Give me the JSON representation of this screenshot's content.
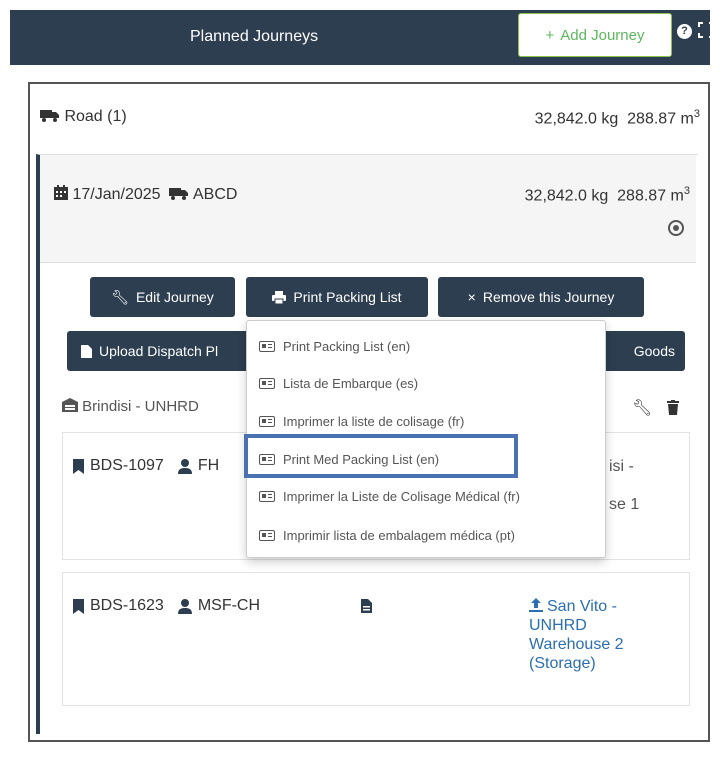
{
  "header": {
    "title": "Planned Journeys",
    "add_label": "Add Journey",
    "help_glyph": "?"
  },
  "road": {
    "label": "Road (1)",
    "weight": "32,842.0 kg",
    "volume": "288.87 m",
    "volume_exp": "3"
  },
  "journey": {
    "date": "17/Jan/2025",
    "vehicle": "ABCD",
    "weight": "32,842.0 kg",
    "volume": "288.87 m",
    "volume_exp": "3"
  },
  "buttons": {
    "edit": "Edit Journey",
    "print": "Print Packing List",
    "remove": "Remove this Journey",
    "upload": "Upload Dispatch Pl",
    "goods": "Goods"
  },
  "origin": "Brindisi - UNHRD",
  "consignments": [
    {
      "ref": "BDS-1097",
      "org": "FH",
      "dest_lines": [
        "isi -",
        "",
        "se 1"
      ]
    },
    {
      "ref": "BDS-1623",
      "org": "MSF-CH",
      "dest_lines": [
        "San Vito -",
        "UNHRD",
        "Warehouse 2",
        "(Storage)"
      ]
    }
  ],
  "print_menu": {
    "items": [
      "Print Packing List (en)",
      "Lista de Embarque (es)",
      "Imprimer la liste de colisage (fr)",
      "Print Med Packing List (en)",
      "Imprimer la Liste de Colisage Médical (fr)",
      "Imprimir lista de embalagem médica (pt)"
    ],
    "highlighted": "Print Med Packing List (en)"
  },
  "colors": {
    "header_bg": "#2c3e50",
    "button_bg": "#2c3e50",
    "accent_green": "#5cb85c",
    "link_blue": "#2a6fb0",
    "highlight_border": "#4a72b0"
  }
}
